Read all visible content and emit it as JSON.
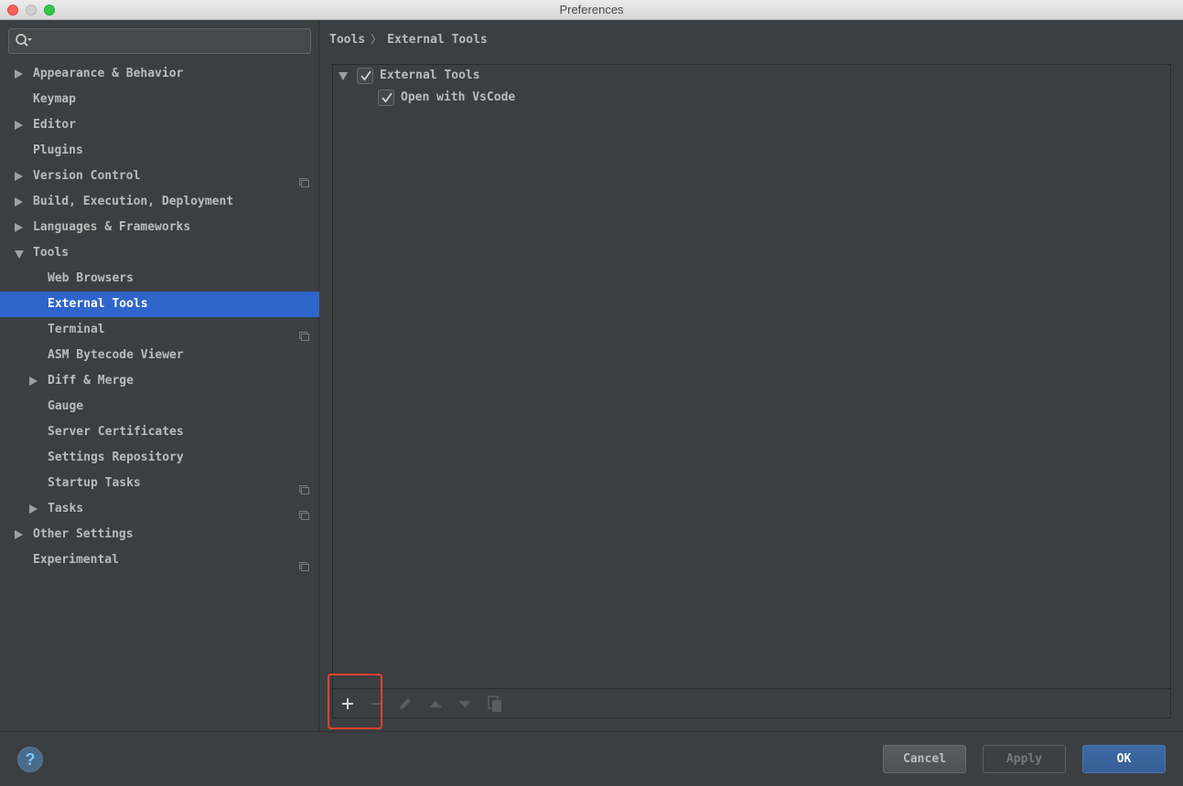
{
  "window": {
    "title": "Preferences"
  },
  "search": {
    "placeholder": ""
  },
  "sidebar": {
    "items": [
      {
        "label": "Appearance & Behavior",
        "level": 0,
        "arrow": "right",
        "project": false
      },
      {
        "label": "Keymap",
        "level": 0,
        "arrow": "none",
        "project": false
      },
      {
        "label": "Editor",
        "level": 0,
        "arrow": "right",
        "project": false
      },
      {
        "label": "Plugins",
        "level": 0,
        "arrow": "none",
        "project": false
      },
      {
        "label": "Version Control",
        "level": 0,
        "arrow": "right",
        "project": true
      },
      {
        "label": "Build, Execution, Deployment",
        "level": 0,
        "arrow": "right",
        "project": false
      },
      {
        "label": "Languages & Frameworks",
        "level": 0,
        "arrow": "right",
        "project": false
      },
      {
        "label": "Tools",
        "level": 0,
        "arrow": "down",
        "project": false
      },
      {
        "label": "Web Browsers",
        "level": 1,
        "arrow": "none",
        "project": false
      },
      {
        "label": "External Tools",
        "level": 1,
        "arrow": "none",
        "project": false,
        "selected": true
      },
      {
        "label": "Terminal",
        "level": 1,
        "arrow": "none",
        "project": true
      },
      {
        "label": "ASM Bytecode Viewer",
        "level": 1,
        "arrow": "none",
        "project": false
      },
      {
        "label": "Diff & Merge",
        "level": 1,
        "arrow": "right",
        "project": false
      },
      {
        "label": "Gauge",
        "level": 1,
        "arrow": "none",
        "project": false
      },
      {
        "label": "Server Certificates",
        "level": 1,
        "arrow": "none",
        "project": false
      },
      {
        "label": "Settings Repository",
        "level": 1,
        "arrow": "none",
        "project": false
      },
      {
        "label": "Startup Tasks",
        "level": 1,
        "arrow": "none",
        "project": true
      },
      {
        "label": "Tasks",
        "level": 1,
        "arrow": "right",
        "project": true
      },
      {
        "label": "Other Settings",
        "level": 0,
        "arrow": "right",
        "project": false
      },
      {
        "label": "Experimental",
        "level": 0,
        "arrow": "none",
        "project": true
      }
    ]
  },
  "breadcrumb": {
    "parent": "Tools",
    "separator": "〉",
    "current": "External Tools"
  },
  "tools_tree": {
    "group": {
      "label": "External Tools",
      "checked": true,
      "expanded": true
    },
    "items": [
      {
        "label": "Open with VsCode",
        "checked": true
      }
    ]
  },
  "toolbar": {
    "buttons": [
      {
        "icon": "add-icon",
        "enabled": true
      },
      {
        "icon": "remove-icon",
        "enabled": false
      },
      {
        "icon": "edit-icon",
        "enabled": false
      },
      {
        "icon": "move-up-icon",
        "enabled": false
      },
      {
        "icon": "move-down-icon",
        "enabled": false
      },
      {
        "icon": "copy-icon",
        "enabled": false
      }
    ],
    "highlight_color": "#e8412c"
  },
  "footer": {
    "help": "?",
    "cancel": "Cancel",
    "apply": "Apply",
    "ok": "OK"
  },
  "colors": {
    "background": "#3c3f41",
    "selection": "#2f65ca",
    "text": "#bbbbbb",
    "ok_button": "#3d6ba6"
  }
}
